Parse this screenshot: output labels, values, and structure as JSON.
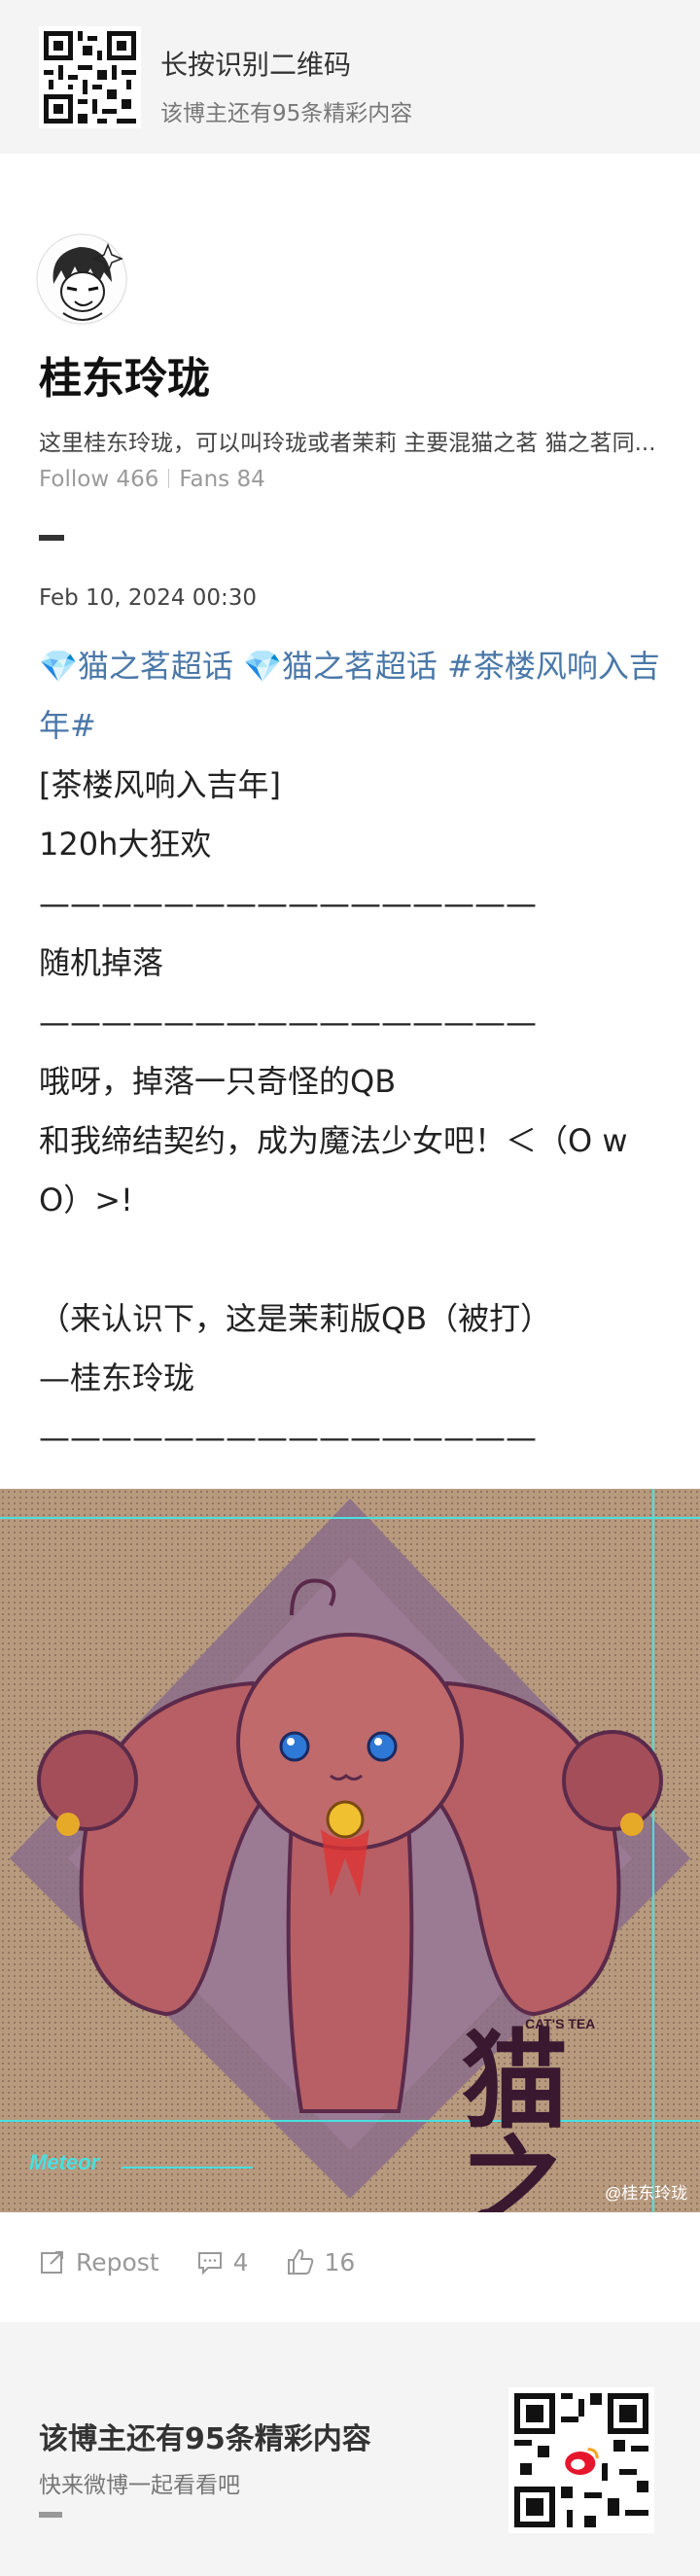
{
  "top_banner": {
    "title": "长按识别二维码",
    "subtitle": "该博主还有95条精彩内容"
  },
  "profile": {
    "name": "桂东玲珑",
    "bio": "这里桂东玲珑，可以叫玲珑或者茉莉 主要混猫之茗 猫之茗同...",
    "follow": "Follow 466",
    "fans": "Fans 84"
  },
  "post": {
    "date": "Feb 10, 2024 00:30",
    "tags_line1": "💎猫之茗超话 💎猫之茗超话 #茶楼风响入吉",
    "tags_line2": "年#",
    "lines": [
      "[茶楼风响入吉年]",
      "120h大狂欢",
      "————————————————",
      "随机掉落",
      "————————————————",
      "哦呀，掉落一只奇怪的QB",
      "和我缔结契约，成为魔法少女吧！＜（O w",
      "O）>!",
      "",
      "（来认识下，这是茉莉版QB（被打）",
      "—桂东玲珑",
      "————————————————"
    ],
    "image": {
      "logo_text": "猫之茗",
      "logo_sub": "CAT'S TEA",
      "artist_sign": "Meteor",
      "watermark": "@桂东玲珑"
    }
  },
  "actions": {
    "repost": "Repost",
    "comments": "4",
    "likes": "16"
  },
  "footer": {
    "title": "该博主还有95条精彩内容",
    "subtitle": "快来微博一起看看吧"
  },
  "colors": {
    "tag": "#4a78a8",
    "banner_bg": "#f4f4f4"
  }
}
